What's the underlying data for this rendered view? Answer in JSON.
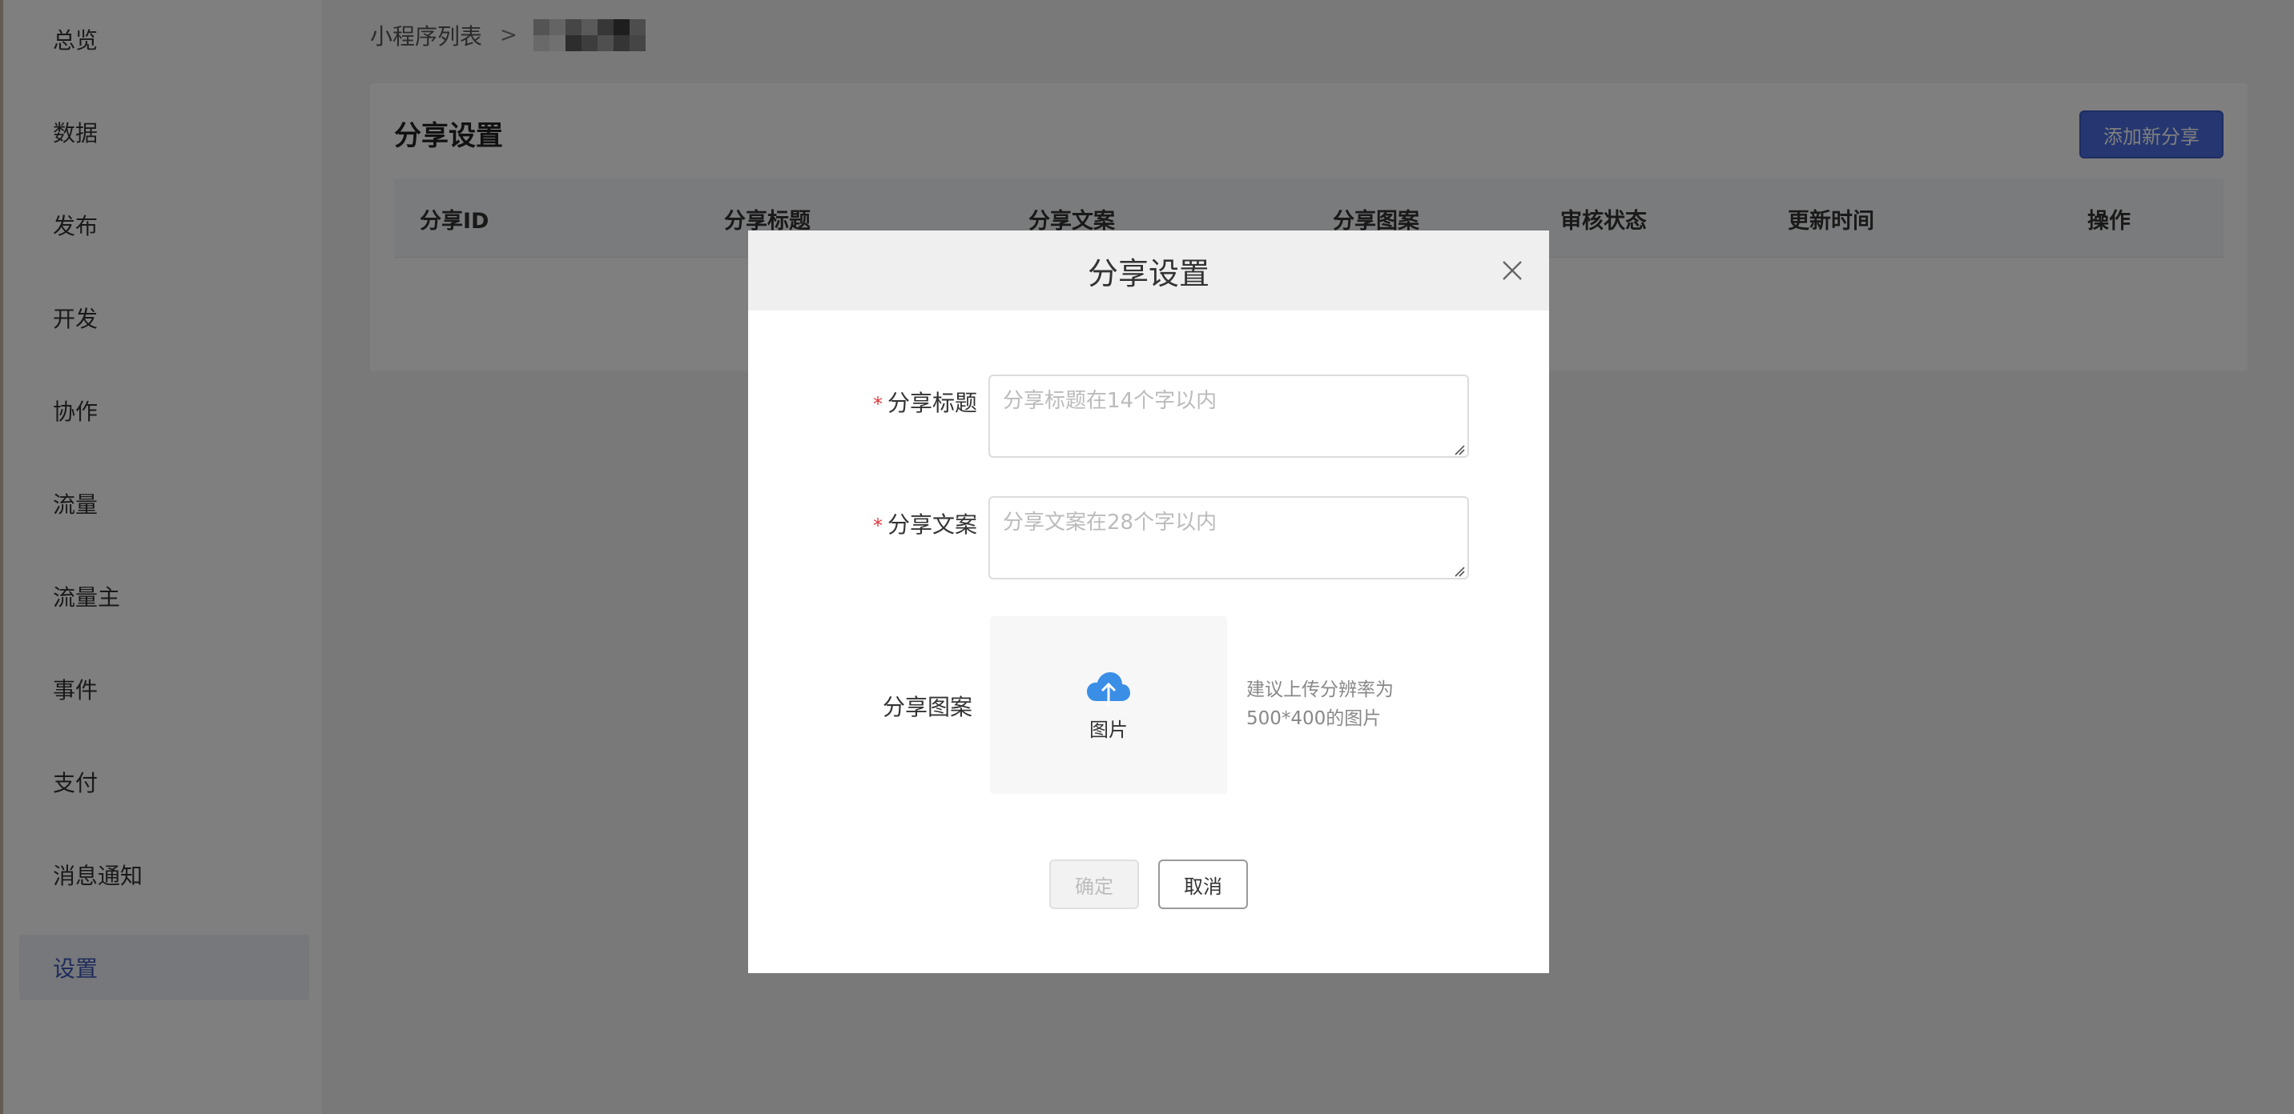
{
  "sidebar": {
    "items": [
      {
        "label": "总览"
      },
      {
        "label": "数据"
      },
      {
        "label": "发布"
      },
      {
        "label": "开发"
      },
      {
        "label": "协作"
      },
      {
        "label": "流量"
      },
      {
        "label": "流量主"
      },
      {
        "label": "事件"
      },
      {
        "label": "支付"
      },
      {
        "label": "消息通知"
      },
      {
        "label": "设置"
      }
    ]
  },
  "breadcrumb": {
    "root": "小程序列表",
    "separator": ">"
  },
  "panel": {
    "title": "分享设置",
    "add_button": "添加新分享",
    "columns": [
      "分享ID",
      "分享标题",
      "分享文案",
      "分享图案",
      "审核状态",
      "更新时间",
      "操作"
    ]
  },
  "modal": {
    "title": "分享设置",
    "fields": {
      "title_label": "分享标题",
      "title_placeholder": "分享标题在14个字以内",
      "desc_label": "分享文案",
      "desc_placeholder": "分享文案在28个字以内",
      "image_label": "分享图案",
      "upload_text": "图片",
      "hint_line1": "建议上传分辨率为",
      "hint_line2": "500*400的图片"
    },
    "required_mark": "*",
    "confirm": "确定",
    "cancel": "取消"
  },
  "colors": {
    "primary": "#4a6ce0",
    "upload_icon": "#3a8ee6",
    "required": "#e4393c"
  }
}
